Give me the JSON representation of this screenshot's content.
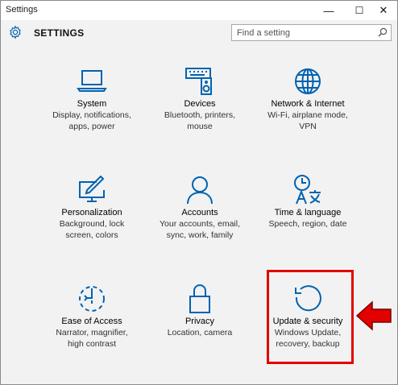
{
  "window": {
    "title": "Settings",
    "controls": {
      "minimize": "—",
      "maximize": "☐",
      "close": "✕"
    }
  },
  "header": {
    "title": "SETTINGS",
    "search_placeholder": "Find a setting"
  },
  "tiles": [
    {
      "name": "System",
      "desc_lines": [
        "Display, notifications,",
        "apps, power"
      ],
      "icon": "laptop-icon"
    },
    {
      "name": "Devices",
      "desc_lines": [
        "Bluetooth, printers,",
        "mouse"
      ],
      "icon": "keyboard-speaker-icon"
    },
    {
      "name": "Network & Internet",
      "desc_lines": [
        "Wi-Fi, airplane mode,",
        "VPN"
      ],
      "icon": "globe-icon"
    },
    {
      "name": "Personalization",
      "desc_lines": [
        "Background, lock",
        "screen, colors"
      ],
      "icon": "paint-monitor-icon"
    },
    {
      "name": "Accounts",
      "desc_lines": [
        "Your accounts, email,",
        "sync, work, family"
      ],
      "icon": "person-icon"
    },
    {
      "name": "Time & language",
      "desc_lines": [
        "Speech, region, date"
      ],
      "icon": "clock-language-icon"
    },
    {
      "name": "Ease of Access",
      "desc_lines": [
        "Narrator, magnifier,",
        "high contrast"
      ],
      "icon": "ease-of-access-icon"
    },
    {
      "name": "Privacy",
      "desc_lines": [
        "Location, camera"
      ],
      "icon": "lock-icon"
    },
    {
      "name": "Update & security",
      "desc_lines": [
        "Windows Update,",
        "recovery, backup"
      ],
      "icon": "refresh-icon"
    }
  ],
  "annotation": {
    "color": "#e20000"
  },
  "colors": {
    "accent": "#0063b1",
    "background": "#f2f2f2"
  }
}
